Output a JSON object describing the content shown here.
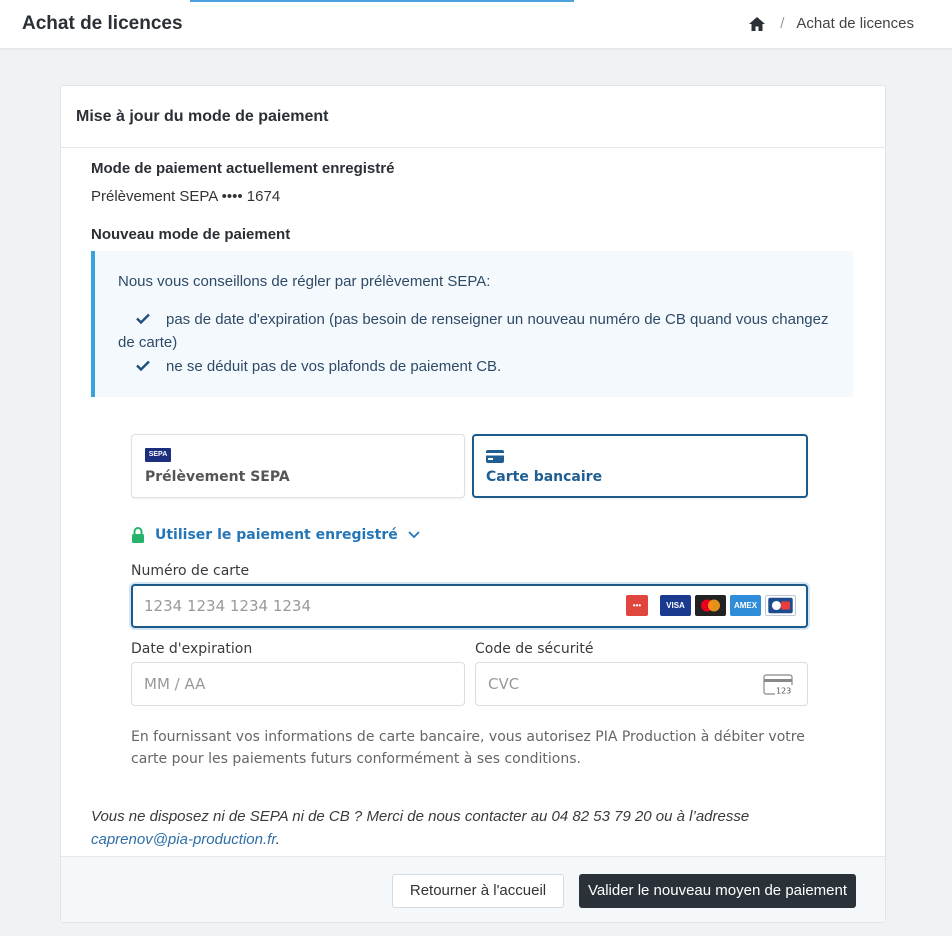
{
  "header": {
    "title": "Achat de licences",
    "breadcrumb": {
      "home_icon": "home-icon",
      "separator": "/",
      "current": "Achat de licences"
    }
  },
  "card": {
    "title": "Mise à jour du mode de paiement",
    "current_label": "Mode de paiement actuellement enregistré",
    "current_value": "Prélèvement SEPA •••• 1674",
    "new_label": "Nouveau mode de paiement",
    "info": {
      "intro": "Nous vous conseillons de régler par prélèvement SEPA:",
      "items": [
        "pas de date d'expiration (pas besoin de renseigner un nouveau numéro de CB quand vous changez de carte)",
        "ne se déduit pas de vos plafonds de paiement CB."
      ]
    },
    "methods": [
      {
        "label": "Prélèvement SEPA",
        "logo_text": "SEPA",
        "selected": false
      },
      {
        "label": "Carte bancaire",
        "icon": "credit-card-icon",
        "selected": true
      }
    ],
    "saved_payment_label": "Utiliser le paiement enregistré",
    "card_number": {
      "label": "Numéro de carte",
      "placeholder": "1234 1234 1234 1234",
      "brands": [
        "CB",
        "VISA",
        "Mastercard",
        "AMEX",
        "CB"
      ]
    },
    "expiry": {
      "label": "Date d'expiration",
      "placeholder": "MM / AA"
    },
    "cvc": {
      "label": "Code de sécurité",
      "placeholder": "CVC",
      "icon_text": "123"
    },
    "legal": "En fournissant vos informations de carte bancaire, vous autorisez PIA Production à débiter votre carte pour les paiements futurs conformément à ses conditions.",
    "contact": {
      "text": "Vous ne disposez ni de SEPA ni de CB ? Merci de nous contacter au 04 82 53 79 20 ou à l’adresse ",
      "email": "caprenov@pia-production.fr",
      "suffix": "."
    },
    "buttons": {
      "back": "Retourner à l'accueil",
      "submit": "Valider le nouveau moyen de paiement"
    }
  },
  "colors": {
    "accent": "#1c5a8c",
    "info_border": "#38a3dd",
    "primary_button": "#2b3139",
    "link": "#2576b8"
  }
}
